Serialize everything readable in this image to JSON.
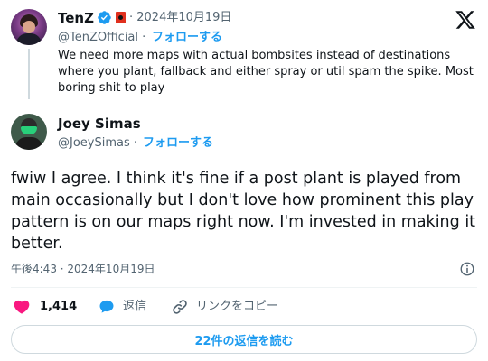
{
  "parent_tweet": {
    "author_name": "TenZ",
    "date": "· 2024年10月19日",
    "handle": "@TenZOfficial ·",
    "follow_label": "フォローする",
    "text": "We need more maps with actual bombsites instead of destinations where you plant, fallback and either spray or util spam the spike. Most boring shit to play"
  },
  "tweet": {
    "author_name": "Joey Simas",
    "handle": "@JoeySimas ·",
    "follow_label": "フォローする",
    "text": "fwiw I agree. I think it's fine if a post plant is played from main occasionally but I don't love how prominent this play pattern is on our maps right now. I'm invested in making it better.",
    "timestamp": "午後4:43 · 2024年10月19日"
  },
  "actions": {
    "like_count": "1,414",
    "reply_label": "返信",
    "share_label": "リンクをコピー"
  },
  "replies_button_label": "22件の返信を読む",
  "colors": {
    "accent": "#1d9bf0",
    "like": "#f91880",
    "secondary_text": "#536471"
  },
  "icons": [
    "verified-badge-icon",
    "flag-icon",
    "x-logo-icon",
    "info-icon",
    "heart-icon",
    "reply-bubble-icon",
    "link-icon"
  ]
}
